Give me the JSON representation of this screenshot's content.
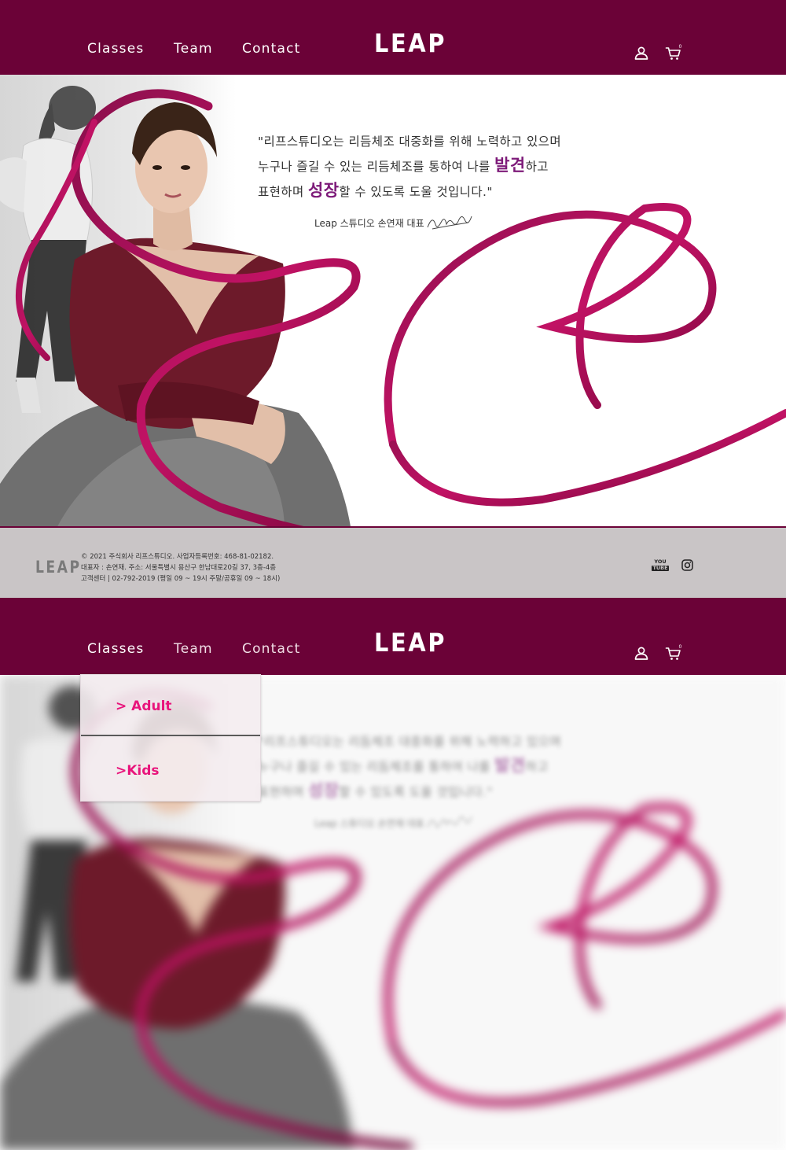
{
  "header": {
    "nav": [
      "Classes",
      "Team",
      "Contact"
    ],
    "logo": "LEAP",
    "user_icon": "user-icon",
    "cart_icon": "cart-icon",
    "cart_count": "0",
    "color": "#6b0237"
  },
  "hero": {
    "quote_line1": "\"리프스튜디오는 리듬체조 대중화를 위해 노력하고 있으며",
    "quote_line2_pre": "누구나 즐길 수 있는 리듬체조를 통하여 나를 ",
    "quote_line2_hl": "발견",
    "quote_line2_post": "하고",
    "quote_line3_pre": "표현하며 ",
    "quote_line3_hl": "성장",
    "quote_line3_post": "할 수 있도록 도울 것입니다.\"",
    "signature_line": "Leap 스튜디오 손연재 대표",
    "signature_icon": "signature-mark",
    "highlight_color": "#7d1a79"
  },
  "footer": {
    "logo": "LEAP",
    "info_line1": "© 2021 주식회사 리프스튜디오. 사업자등록번호: 468-81-02182.",
    "info_line2": "대표자 : 손연재. 주소: 서울특별시 용산구 한남대로20길 37, 3층-4층",
    "info_line3": "고객센터 | 02-792-2019 (평일 09 ~ 19시 주말/공휴일 09 ~ 18시)",
    "youtube_top": "YOU",
    "youtube_bottom": "TUBE",
    "instagram_icon": "instagram-icon",
    "background": "#c9c5c6"
  },
  "dropdown": {
    "items": [
      "Adult",
      "Kids"
    ],
    "chevron": ">",
    "accent": "#e8157c"
  }
}
